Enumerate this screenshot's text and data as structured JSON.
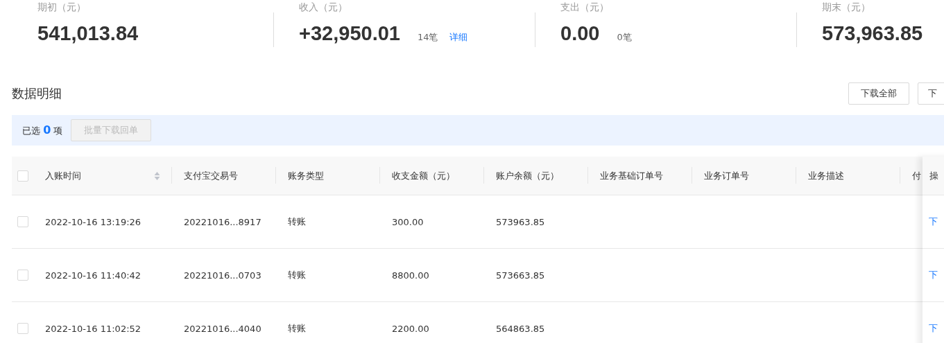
{
  "summary": [
    {
      "label": "期初（元）",
      "value": "541,013.84"
    },
    {
      "label": "收入（元）",
      "value": "+32,950.01",
      "count": "14笔",
      "link": "详细"
    },
    {
      "label": "支出（元）",
      "value": "0.00",
      "count": "0笔"
    },
    {
      "label": "期末（元）",
      "value": "573,963.85"
    }
  ],
  "section": {
    "title": "数据明细",
    "buttons": [
      "下载全部",
      "下"
    ]
  },
  "selection": {
    "prefix": "已选",
    "count": "0",
    "suffix": "项",
    "button": {
      "label": "批量下载回单",
      "disabled": true
    }
  },
  "table": {
    "select_all_checked": false,
    "columns": [
      {
        "label": "入账时间",
        "sortable": true
      },
      {
        "label": "支付宝交易号",
        "sortable": false
      },
      {
        "label": "账务类型",
        "sortable": false
      },
      {
        "label": "收支金额（元）",
        "sortable": false
      },
      {
        "label": "账户余额（元）",
        "sortable": false
      },
      {
        "label": "业务基础订单号",
        "sortable": false
      },
      {
        "label": "业务订单号",
        "sortable": false
      },
      {
        "label": "业务描述",
        "sortable": false
      },
      {
        "label": "付"
      }
    ],
    "action_column": "操",
    "rows": [
      {
        "checked": false,
        "cells": [
          "2022-10-16 13:19:26",
          "20221016...8917",
          "转账",
          "300.00",
          "573963.85",
          "",
          "",
          "",
          ""
        ],
        "action": "下"
      },
      {
        "checked": false,
        "cells": [
          "2022-10-16 11:40:42",
          "20221016...0703",
          "转账",
          "8800.00",
          "573663.85",
          "",
          "",
          "",
          ""
        ],
        "action": "下"
      },
      {
        "checked": false,
        "cells": [
          "2022-10-16 11:02:52",
          "20221016...4040",
          "转账",
          "2200.00",
          "564863.85",
          "",
          "",
          "",
          ""
        ],
        "action": "下"
      }
    ]
  }
}
